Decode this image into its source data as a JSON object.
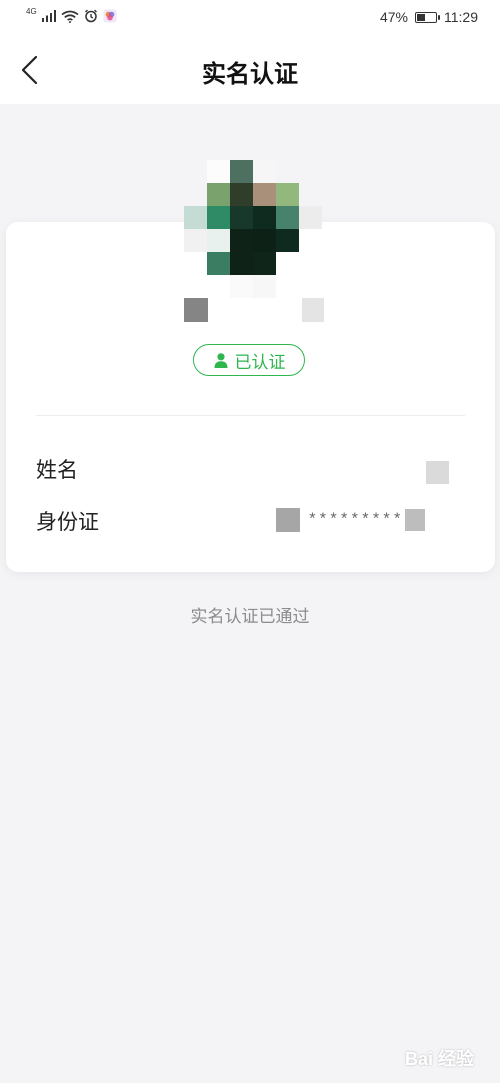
{
  "status_bar": {
    "network": "4G",
    "battery_percent": "47%",
    "battery_level": 0.47,
    "time": "11:29"
  },
  "nav": {
    "back_icon": "chevron-left-icon",
    "title": "实名认证"
  },
  "profile": {
    "avatar": "pixelated-avatar",
    "nickname": "",
    "badge_icon": "person-icon",
    "badge_label": "已认证",
    "badge_color": "#2fb64f"
  },
  "details": {
    "name_label": "姓名",
    "name_value": "",
    "id_label": "身份证",
    "id_value_masked": "*********"
  },
  "status_text": "实名认证已通过",
  "watermark": "Bai 经验"
}
